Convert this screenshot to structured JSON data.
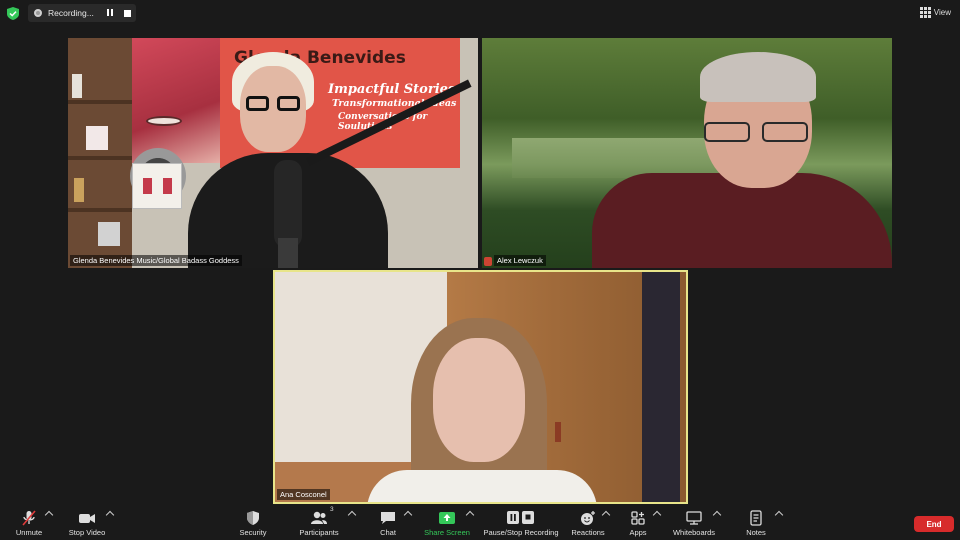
{
  "recording": {
    "status_text": "Recording..."
  },
  "header": {
    "view_label": "View"
  },
  "participants": [
    {
      "name": "Glenda Benevides Music/Global Badass Goddess"
    },
    {
      "name": "Alex Lewczuk"
    },
    {
      "name": "Ana Cosconel"
    }
  ],
  "banner": {
    "title": "Glenda Benevides Music",
    "line1": "Impactful Stories",
    "line2": "Transformational Ideas",
    "line3": "Conversations for Soulutions"
  },
  "toolbar": {
    "unmute": "Unmute",
    "stop_video": "Stop Video",
    "security": "Security",
    "participants": "Participants",
    "participants_count": "3",
    "chat": "Chat",
    "share_screen": "Share Screen",
    "pause_stop_recording": "Pause/Stop Recording",
    "reactions": "Reactions",
    "apps": "Apps",
    "whiteboards": "Whiteboards",
    "notes": "Notes",
    "end": "End"
  },
  "colors": {
    "share_screen_accent": "#34c759",
    "end_button": "#d72b2b",
    "active_speaker_border": "#e8e58a",
    "security_shield": "#34c759"
  }
}
